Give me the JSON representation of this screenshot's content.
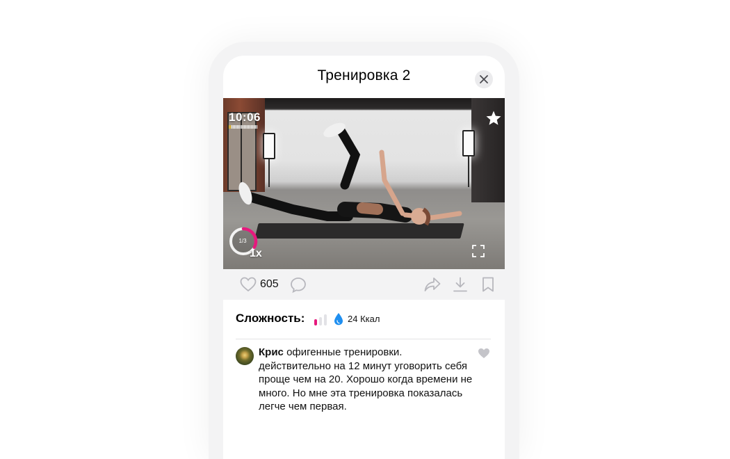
{
  "header": {
    "title": "Тренировка 2"
  },
  "video": {
    "time": "10:06",
    "progress_label": "1/3",
    "progress": 0.33,
    "speed": "1x"
  },
  "actions": {
    "likes": "605"
  },
  "info": {
    "difficulty_label": "Сложность:",
    "difficulty_level": 1,
    "difficulty_max": 3,
    "kcal": "24 Ккал"
  },
  "comment": {
    "author": "Крис",
    "text_first": "офигенные тренировки.",
    "text_rest": "действительно на 12 минут уговорить себя проще чем на 20. Хорошо когда времени не много. Но мне эта тренировка показалась легче чем первая."
  },
  "colors": {
    "accent": "#e6197d",
    "kcal_blue": "#1f8ff0",
    "icon_grey": "#b7b7bd"
  },
  "icons": [
    "close-icon",
    "star-icon",
    "fullscreen-icon",
    "heart-icon",
    "comment-icon",
    "share-icon",
    "download-icon",
    "bookmark-icon",
    "drop-icon"
  ]
}
